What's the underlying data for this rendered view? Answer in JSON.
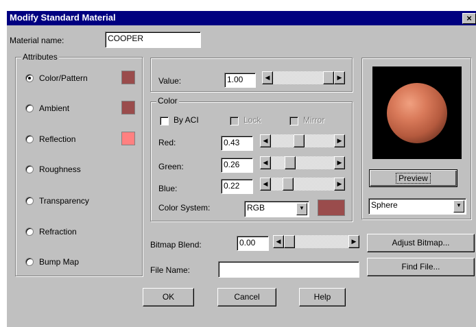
{
  "window": {
    "title": "Modify Standard Material",
    "close_glyph": "×"
  },
  "material_name": {
    "label": "Material name:",
    "value": "COOPER"
  },
  "attributes": {
    "legend": "Attributes",
    "items": [
      {
        "label": "Color/Pattern",
        "selected": true,
        "swatch": "#9a4c4c"
      },
      {
        "label": "Ambient",
        "selected": false,
        "swatch": "#9a4c4c"
      },
      {
        "label": "Reflection",
        "selected": false,
        "swatch": "#ff8080"
      },
      {
        "label": "Roughness",
        "selected": false
      },
      {
        "label": "Transparency",
        "selected": false
      },
      {
        "label": "Refraction",
        "selected": false
      },
      {
        "label": "Bump Map",
        "selected": false
      }
    ]
  },
  "value": {
    "label": "Value:",
    "value": "1.00",
    "slider_fraction": 1.0
  },
  "color": {
    "legend": "Color",
    "by_aci_label": "By ACI",
    "lock_label": "Lock",
    "mirror_label": "Mirror",
    "red": {
      "label": "Red:",
      "value": "0.43",
      "slider_fraction": 0.43
    },
    "green": {
      "label": "Green:",
      "value": "0.26",
      "slider_fraction": 0.26
    },
    "blue": {
      "label": "Blue:",
      "value": "0.22",
      "slider_fraction": 0.22
    },
    "system_label": "Color System:",
    "system_value": "RGB",
    "swatch": "#9a4c4c"
  },
  "preview": {
    "button_label": "Preview",
    "shape_value": "Sphere"
  },
  "bitmap": {
    "blend_label": "Bitmap Blend:",
    "blend_value": "0.00",
    "slider_fraction": 0.0,
    "file_label": "File Name:",
    "file_value": ""
  },
  "buttons": {
    "adjust_bitmap": "Adjust Bitmap...",
    "find_file": "Find File...",
    "ok": "OK",
    "cancel": "Cancel",
    "help": "Help"
  },
  "colors": {
    "title_bar": "#000080",
    "dialog_face": "#c0c0c0"
  }
}
